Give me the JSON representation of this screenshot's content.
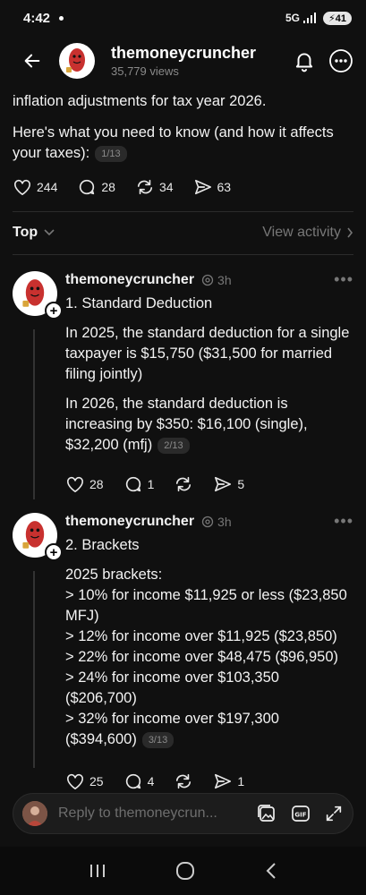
{
  "status_bar": {
    "time": "4:42",
    "network": "5G",
    "battery": "41"
  },
  "header": {
    "username": "themoneycruncher",
    "views": "35,779 views"
  },
  "main_post": {
    "line1": "inflation adjustments for tax year 2026.",
    "line2": "Here's what you need to know (and how it affects your taxes):",
    "pager": "1/13",
    "likes": "244",
    "comments": "28",
    "reposts": "34",
    "shares": "63"
  },
  "sort": {
    "label": "Top",
    "view_activity": "View activity"
  },
  "replies": [
    {
      "username": "themoneycruncher",
      "time": "3h",
      "title": "1. Standard Deduction",
      "para1": "In 2025, the standard deduction for a single taxpayer is $15,750 ($31,500 for married filing jointly)",
      "para2": "In 2026, the standard deduction is increasing by $350: $16,100 (single), $32,200 (mfj)",
      "pager": "2/13",
      "likes": "28",
      "comments": "1",
      "shares": "5"
    },
    {
      "username": "themoneycruncher",
      "time": "3h",
      "title": "2. Brackets",
      "intro": "2025 brackets:",
      "lines": [
        "> 10% for income $11,925 or less ($23,850 MFJ)",
        "> 12% for income over $11,925 ($23,850)",
        "> 22% for income over $48,475 ($96,950)",
        "> 24% for income over $103,350 ($206,700)",
        "> 32% for income over $197,300 ($394,600)"
      ],
      "pager": "3/13",
      "likes": "25",
      "comments": "4",
      "shares": "1"
    }
  ],
  "reply_bar": {
    "placeholder": "Reply to themoneycrun..."
  },
  "colors": {
    "background": "#101010",
    "text": "#f3f3f3",
    "muted": "#777777",
    "divider": "#2c2c2c"
  }
}
